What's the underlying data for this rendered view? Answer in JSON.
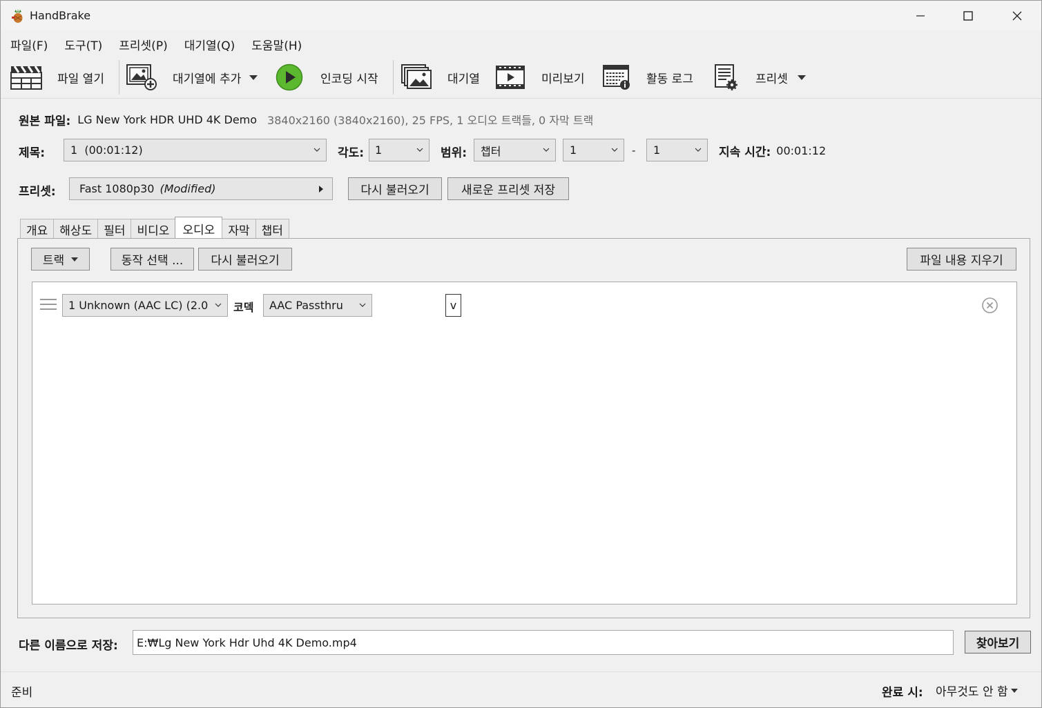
{
  "window": {
    "title": "HandBrake"
  },
  "menu": [
    {
      "label": "파일(F)"
    },
    {
      "label": "도구(T)"
    },
    {
      "label": "프리셋(P)"
    },
    {
      "label": "대기열(Q)"
    },
    {
      "label": "도움말(H)"
    }
  ],
  "toolbar": {
    "open_file": "파일 열기",
    "add_queue": "대기열에 추가",
    "start_encode": "인코딩 시작",
    "queue": "대기열",
    "preview": "미리보기",
    "activity_log": "활동 로그",
    "presets": "프리셋"
  },
  "source": {
    "label": "원본 파일:",
    "name": "LG New York HDR UHD 4K Demo",
    "info": "3840x2160 (3840x2160), 25 FPS, 1 오디오 트랙들, 0 자막 트랙"
  },
  "title_row": {
    "title_label": "제목:",
    "title_value": "1  (00:01:12)",
    "angle_label": "각도:",
    "angle_value": "1",
    "range_label": "범위:",
    "range_type": "챕터",
    "range_start": "1",
    "range_dash": "-",
    "range_end": "1",
    "duration_label": "지속 시간:",
    "duration_value": "00:01:12"
  },
  "preset_row": {
    "label": "프리셋:",
    "name": "Fast 1080p30",
    "modified": "(Modified)",
    "reload_button": "다시 불러오기",
    "save_new_button": "새로운 프리셋 저장"
  },
  "tabs": [
    {
      "label": "개요"
    },
    {
      "label": "해상도"
    },
    {
      "label": "필터"
    },
    {
      "label": "비디오"
    },
    {
      "label": "오디오"
    },
    {
      "label": "자막"
    },
    {
      "label": "챕터"
    }
  ],
  "audio": {
    "track_button": "트랙",
    "choose_behavior_button": "동작 선택 ...",
    "reload_button": "다시 불러오기",
    "clear_button": "파일 내용 지우기",
    "track": {
      "source": "1 Unknown (AAC LC) (2.0",
      "codec_label": "코덱",
      "codec_value": "AAC Passthru",
      "extra_value": "v"
    }
  },
  "save_as": {
    "label": "다른 이름으로 저장:",
    "path": "E:₩Lg New York Hdr Uhd 4K Demo.mp4",
    "browse_button": "찾아보기"
  },
  "status": {
    "text": "준비",
    "when_done_label": "완료 시:",
    "when_done_value": "아무것도 안 함"
  },
  "colors": {
    "play_green": "#5cb82e",
    "accent_border": "#8a8a8a"
  }
}
